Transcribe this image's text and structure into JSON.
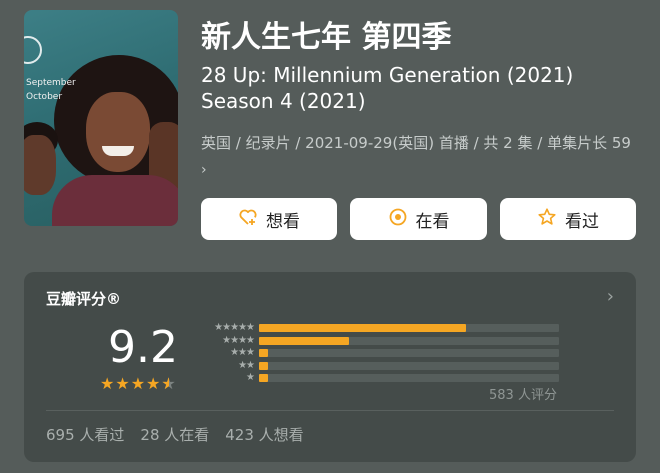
{
  "poster": {
    "text_line1": "September",
    "text_line2": "October"
  },
  "title": {
    "chinese": "新人生七年 第四季",
    "english": "28 Up: Millennium Generation (2021) Season 4 (2021)"
  },
  "meta": {
    "text": "英国 / 纪录片 / 2021-09-29(英国) 首播 / 共 2 集 / 单集片长 59",
    "chevron": "›"
  },
  "actions": [
    {
      "label": "想看",
      "icon": "heart-plus-icon"
    },
    {
      "label": "在看",
      "icon": "target-icon"
    },
    {
      "label": "看过",
      "icon": "star-outline-icon"
    }
  ],
  "rating": {
    "title": "豆瓣评分®",
    "score": "9.2",
    "stars": 4.5,
    "distribution_labels": [
      "★★★★★",
      "★★★★",
      "★★★",
      "★★",
      "★"
    ],
    "distribution": [
      0.69,
      0.3,
      0.03,
      0.03,
      0.03
    ],
    "raters": "583 人评分"
  },
  "counts": {
    "watched": "695 人看过",
    "watching": "28 人在看",
    "want": "423 人想看"
  },
  "colors": {
    "accent": "#f5a623",
    "background": "#555c5a",
    "card": "#444b49"
  }
}
